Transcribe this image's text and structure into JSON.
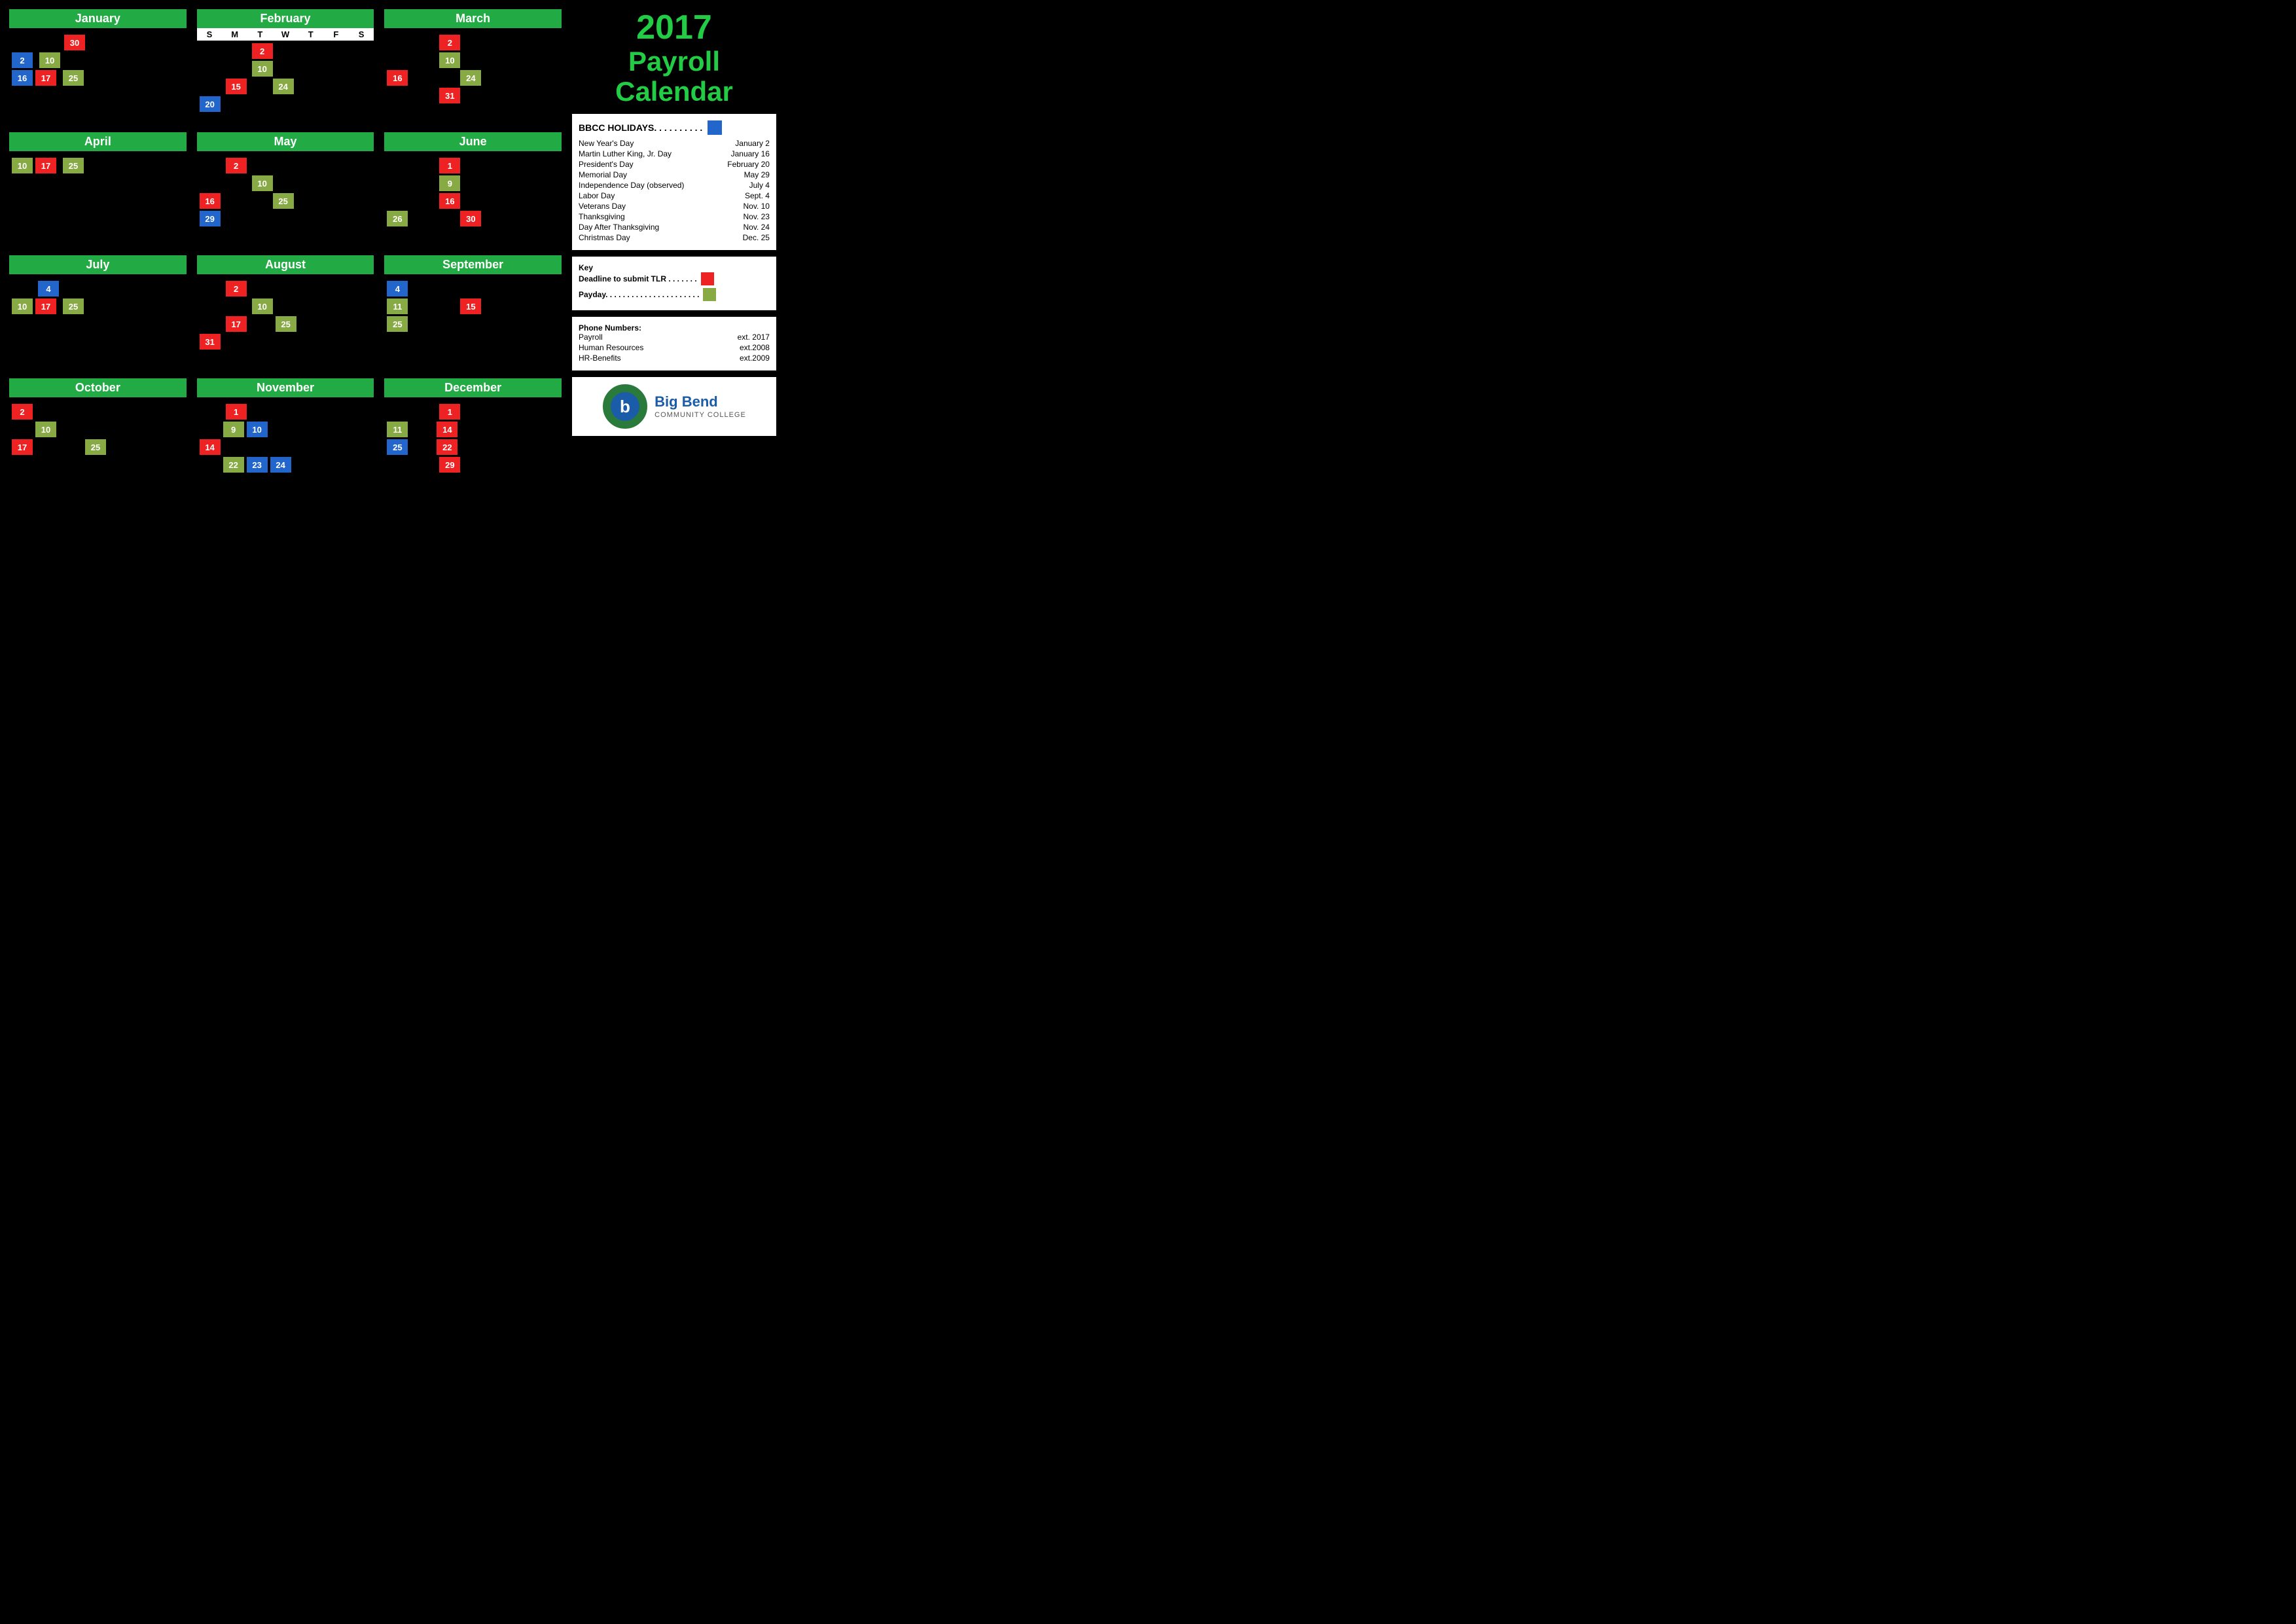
{
  "title": {
    "year": "2017",
    "line1": "Payroll",
    "line2": "Calendar"
  },
  "months": {
    "january": {
      "name": "January",
      "dates": [
        {
          "row": [
            {
              "num": "30",
              "color": "red",
              "indent": 2
            }
          ]
        },
        {
          "row": [
            {
              "num": "2",
              "color": "blue",
              "indent": 0
            },
            {
              "num": "10",
              "color": "green",
              "indent": 1
            }
          ]
        },
        {
          "row": [
            {
              "num": "16",
              "color": "blue",
              "indent": 0
            },
            {
              "num": "17",
              "color": "red",
              "indent": 0
            },
            {
              "num": "25",
              "color": "green",
              "indent": 1
            }
          ]
        }
      ]
    },
    "february": {
      "name": "February",
      "dow": [
        "S",
        "M",
        "T",
        "W",
        "T",
        "F",
        "S"
      ],
      "dates": [
        {
          "row": [
            {
              "num": "2",
              "color": "red",
              "indent": 2
            }
          ]
        },
        {
          "row": [
            {
              "num": "10",
              "color": "green",
              "indent": 2
            }
          ]
        },
        {
          "row": [
            {
              "num": "15",
              "color": "red",
              "indent": 1
            },
            {
              "num": "24",
              "color": "green",
              "indent": 2
            }
          ]
        },
        {
          "row": [
            {
              "num": "20",
              "color": "blue",
              "indent": 0
            }
          ]
        }
      ]
    },
    "march": {
      "name": "March",
      "dates": [
        {
          "row": [
            {
              "num": "2",
              "color": "red",
              "indent": 2
            }
          ]
        },
        {
          "row": [
            {
              "num": "10",
              "color": "green",
              "indent": 2
            }
          ]
        },
        {
          "row": [
            {
              "num": "16",
              "color": "red",
              "indent": 0
            },
            {
              "num": "24",
              "color": "green",
              "indent": 2
            }
          ]
        },
        {
          "row": [
            {
              "num": "31",
              "color": "red",
              "indent": 2
            }
          ]
        }
      ]
    },
    "april": {
      "name": "April",
      "dates": [
        {
          "row": [
            {
              "num": "10",
              "color": "green",
              "indent": 0
            },
            {
              "num": "17",
              "color": "red",
              "indent": 0
            },
            {
              "num": "25",
              "color": "green",
              "indent": 1
            }
          ]
        }
      ]
    },
    "may": {
      "name": "May",
      "dates": [
        {
          "row": [
            {
              "num": "2",
              "color": "red",
              "indent": 1
            }
          ]
        },
        {
          "row": [
            {
              "num": "10",
              "color": "green",
              "indent": 2
            }
          ]
        },
        {
          "row": [
            {
              "num": "16",
              "color": "red",
              "indent": 0
            },
            {
              "num": "25",
              "color": "green",
              "indent": 2
            }
          ]
        },
        {
          "row": [
            {
              "num": "29",
              "color": "blue",
              "indent": 0
            }
          ]
        }
      ]
    },
    "june": {
      "name": "June",
      "dates": [
        {
          "row": [
            {
              "num": "1",
              "color": "red",
              "indent": 2
            }
          ]
        },
        {
          "row": [
            {
              "num": "9",
              "color": "green",
              "indent": 2
            }
          ]
        },
        {
          "row": [
            {
              "num": "16",
              "color": "red",
              "indent": 2
            }
          ]
        },
        {
          "row": [
            {
              "num": "26",
              "color": "green",
              "indent": 0
            },
            {
              "num": "30",
              "color": "red",
              "indent": 2
            }
          ]
        }
      ]
    },
    "july": {
      "name": "July",
      "dates": [
        {
          "row": [
            {
              "num": "4",
              "color": "blue",
              "indent": 1
            }
          ]
        },
        {
          "row": [
            {
              "num": "10",
              "color": "green",
              "indent": 0
            },
            {
              "num": "17",
              "color": "red",
              "indent": 0
            },
            {
              "num": "25",
              "color": "green",
              "indent": 1
            }
          ]
        }
      ]
    },
    "august": {
      "name": "August",
      "dates": [
        {
          "row": [
            {
              "num": "2",
              "color": "red",
              "indent": 1
            }
          ]
        },
        {
          "row": [
            {
              "num": "10",
              "color": "green",
              "indent": 2
            }
          ]
        },
        {
          "row": [
            {
              "num": "17",
              "color": "red",
              "indent": 1
            },
            {
              "num": "25",
              "color": "green",
              "indent": 2
            }
          ]
        },
        {
          "row": [
            {
              "num": "31",
              "color": "red",
              "indent": 0
            }
          ]
        }
      ]
    },
    "september": {
      "name": "September",
      "dates": [
        {
          "row": [
            {
              "num": "4",
              "color": "blue",
              "indent": 0
            },
            {
              "num": "11",
              "color": "green",
              "indent": 0
            },
            {
              "num": "15",
              "color": "red",
              "indent": 2
            }
          ]
        },
        {
          "row": [
            {
              "num": "25",
              "color": "green",
              "indent": 0
            }
          ]
        }
      ]
    },
    "october": {
      "name": "October",
      "dates": [
        {
          "row": [
            {
              "num": "2",
              "color": "red",
              "indent": 0
            }
          ]
        },
        {
          "row": [
            {
              "num": "10",
              "color": "green",
              "indent": 1
            },
            {
              "num": "17",
              "color": "red",
              "indent": 0
            },
            {
              "num": "25",
              "color": "green",
              "indent": 2
            }
          ]
        }
      ]
    },
    "november": {
      "name": "November",
      "dates": [
        {
          "row": [
            {
              "num": "1",
              "color": "red",
              "indent": 1
            }
          ]
        },
        {
          "row": [
            {
              "num": "9",
              "color": "green",
              "indent": 1
            },
            {
              "num": "10",
              "color": "blue",
              "indent": 0
            }
          ]
        },
        {
          "row": [
            {
              "num": "14",
              "color": "red",
              "indent": 0
            },
            {
              "num": "22",
              "color": "green",
              "indent": 1
            },
            {
              "num": "23",
              "color": "blue",
              "indent": 0
            },
            {
              "num": "24",
              "color": "blue",
              "indent": 0
            }
          ]
        }
      ]
    },
    "december": {
      "name": "December",
      "dates": [
        {
          "row": [
            {
              "num": "1",
              "color": "red",
              "indent": 2
            }
          ]
        },
        {
          "row": [
            {
              "num": "11",
              "color": "green",
              "indent": 0
            },
            {
              "num": "14",
              "color": "red",
              "indent": 2
            }
          ]
        },
        {
          "row": [
            {
              "num": "22",
              "color": "red",
              "indent": 2
            },
            {
              "num": "25",
              "color": "blue",
              "indent": 0
            }
          ]
        },
        {
          "row": [
            {
              "num": "29",
              "color": "red",
              "indent": 2
            }
          ]
        }
      ]
    }
  },
  "holidays": {
    "title": "BBCC HOLIDAYS. . . . . . . . . .",
    "items": [
      {
        "name": "New Year's Day",
        "date": "January 2"
      },
      {
        "name": "Martin Luther King, Jr. Day",
        "date": "January 16"
      },
      {
        "name": "President's Day",
        "date": "February 20"
      },
      {
        "name": "Memorial Day",
        "date": "May 29"
      },
      {
        "name": "Independence Day (observed)",
        "date": "July 4"
      },
      {
        "name": "Labor Day",
        "date": "Sept. 4"
      },
      {
        "name": "Veterans Day",
        "date": "Nov. 10"
      },
      {
        "name": "Thanksgiving",
        "date": "Nov. 23"
      },
      {
        "name": "Day After Thanksgiving",
        "date": "Nov. 24"
      },
      {
        "name": "Christmas Day",
        "date": "Dec. 25"
      }
    ]
  },
  "key": {
    "title": "Key",
    "deadline_label": "Deadline to submit TLR . . . . . . . ",
    "payday_label": "Payday. . . . . . . . . . . . . . . . . . . . . "
  },
  "phone": {
    "title": "Phone Numbers:",
    "items": [
      {
        "name": "Payroll",
        "ext": "ext. 2017"
      },
      {
        "name": "Human Resources",
        "ext": "ext.2008"
      },
      {
        "name": "HR-Benefits",
        "ext": "ext.2009"
      }
    ]
  },
  "logo": {
    "letter": "b",
    "name": "Big Bend",
    "sub": "COMMUNITY COLLEGE"
  }
}
